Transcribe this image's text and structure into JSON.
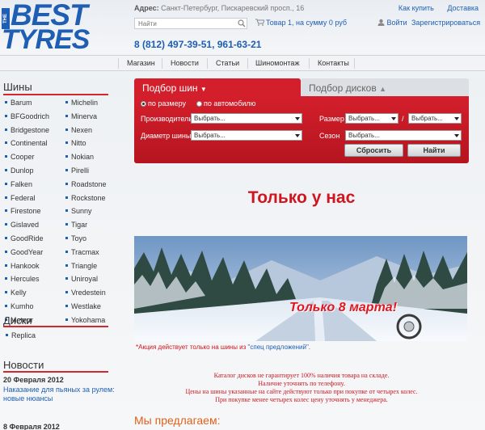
{
  "logo": {
    "the": "THE",
    "line1": "BEST",
    "line2": "TYRES"
  },
  "header": {
    "address_label": "Адрес:",
    "address_value": "Санкт-Петербург, Пискаревский просп., 16",
    "how_to_buy": "Как купить",
    "delivery": "Доставка",
    "search_placeholder": "Найти",
    "cart_text": "Товар 1,  на сумму 0 руб",
    "login": "Войти",
    "register": "Зарегистрироваться",
    "phone": "8 (812) 497-39-51,  961-63-21"
  },
  "nav": [
    "Магазин",
    "Новости",
    "Статьи",
    "Шиномонтаж",
    "Контакты"
  ],
  "sidebar": {
    "tyres_title": "Шины",
    "brands_left": [
      "Barum",
      "BFGoodrich",
      "Bridgestone",
      "Continental",
      "Cooper",
      "Dunlop",
      "Falken",
      "Federal",
      "Firestone",
      "Gislaved",
      "GoodRide",
      "GoodYear",
      "Hankook",
      "Hercules",
      "Kelly",
      "Kumho",
      "Meteor"
    ],
    "brands_right": [
      "Michelin",
      "Minerva",
      "Nexen",
      "Nitto",
      "Nokian",
      "Pirelli",
      "Roadstone",
      "Rockstone",
      "Sunny",
      "Tigar",
      "Toyo",
      "Tracmax",
      "Triangle",
      "Uniroyal",
      "Vredestein",
      "Westlake",
      "Yokohama"
    ],
    "disks_title": "Диски",
    "disks": [
      "Replica"
    ],
    "news_title": "Новости",
    "news": [
      {
        "date": "20 Февраля 2012",
        "lines": [
          "Наказание для пьяных за рулем:",
          "новые нюансы"
        ]
      },
      {
        "date": "8 Февраля 2012",
        "lines": []
      }
    ]
  },
  "picker": {
    "tab_tyres": "Подбор шин",
    "tab_disks": "Подбор дисков",
    "by_size": "по размеру",
    "by_car": "по автомобилю",
    "manufacturer_label": "Производитель",
    "diameter_label": "Диаметр шины",
    "size_label": "Размер",
    "season_label": "Сезон",
    "select_placeholder": "Выбрать...",
    "slash": "/",
    "reset": "Сбросить",
    "find": "Найти"
  },
  "promo": {
    "title": "Только у нас",
    "banner_text": "Только 8 марта!",
    "note_prefix": "*Акция действует только на шины из ",
    "note_link": "\"спец предложений\"",
    "note_suffix": ".",
    "disclaimer": [
      "Каталог дисков не гарантирует 100% наличия товара на складе.",
      "Наличие уточнять по телефону.",
      "Цены на шины указанные на сайте действуют только при покупке от четырех колес.",
      "При покупке менее четырех колес цену уточнять у менеджера."
    ],
    "offer_title": "Мы предлагаем:"
  },
  "colors": {
    "brand_blue": "#1e5fb4",
    "accent_red": "#d31f2b"
  }
}
